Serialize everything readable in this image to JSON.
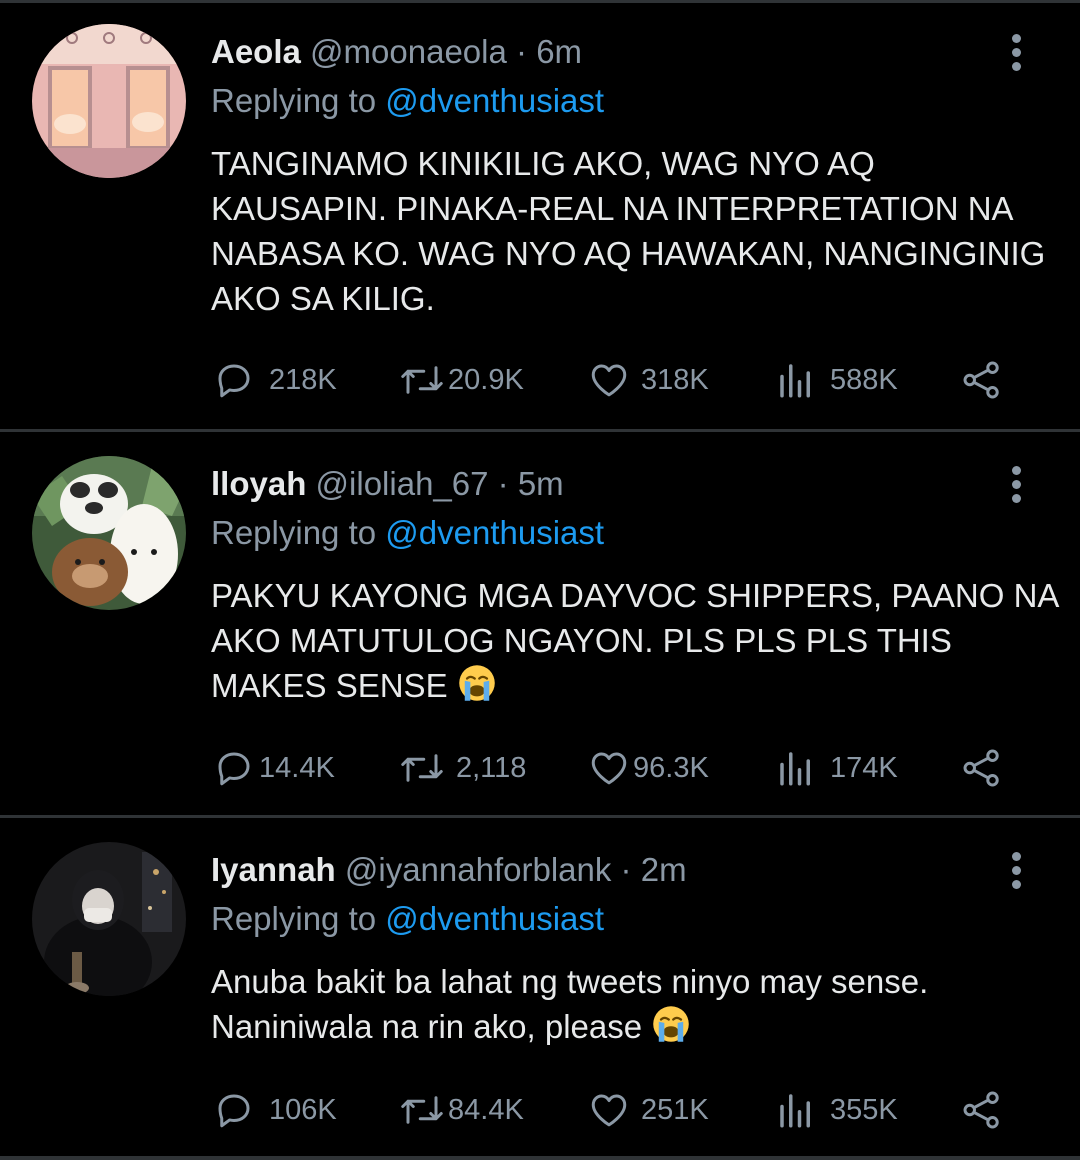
{
  "tweets": [
    {
      "name": "Aeola",
      "handle": "@moonaeola",
      "dot": "·",
      "time": "6m",
      "replying_prefix": "Replying to",
      "replying_to": "@dventhusiast",
      "text": "TANGINAMO KINIKILIG AKO, WAG NYO AQ KAUSAPIN. PINAKA-REAL NA INTERPRETATION NA NABASA KO. WAG NYO AQ HAWAKAN, NANGINGINIG AKO SA KILIG.",
      "emoji": "",
      "replies": "218K",
      "retweets": "20.9K",
      "likes": "318K",
      "views": "588K"
    },
    {
      "name": "lloyah",
      "handle": "@iloliah_67",
      "dot": "·",
      "time": "5m",
      "replying_prefix": "Replying to",
      "replying_to": "@dventhusiast",
      "text": "PAKYU KAYONG MGA DAYVOC SHIPPERS, PAANO NA AKO MATUTULOG NGAYON. PLS PLS PLS THIS MAKES SENSE ",
      "emoji": "loudly-crying-face",
      "replies": "14.4K",
      "retweets": "2,118",
      "likes": "96.3K",
      "views": "174K"
    },
    {
      "name": "Iyannah",
      "handle": "@iyannahforblank",
      "dot": "·",
      "time": "2m",
      "replying_prefix": "Replying to",
      "replying_to": "@dventhusiast",
      "text": "Anuba bakit ba lahat ng tweets ninyo may sense. Naniniwala na rin ako, please ",
      "emoji": "loudly-crying-face",
      "replies": "106K",
      "retweets": "84.4K",
      "likes": "251K",
      "views": "355K"
    }
  ],
  "colors": {
    "background": "#000000",
    "primary_text": "#e7e9ea",
    "secondary_text": "#8b98a5",
    "link": "#1d9bf0",
    "divider": "#2f3336"
  },
  "icons": [
    "reply-icon",
    "retweet-icon",
    "like-icon",
    "views-icon",
    "share-icon",
    "more-icon",
    "loudly-crying-face-emoji"
  ]
}
